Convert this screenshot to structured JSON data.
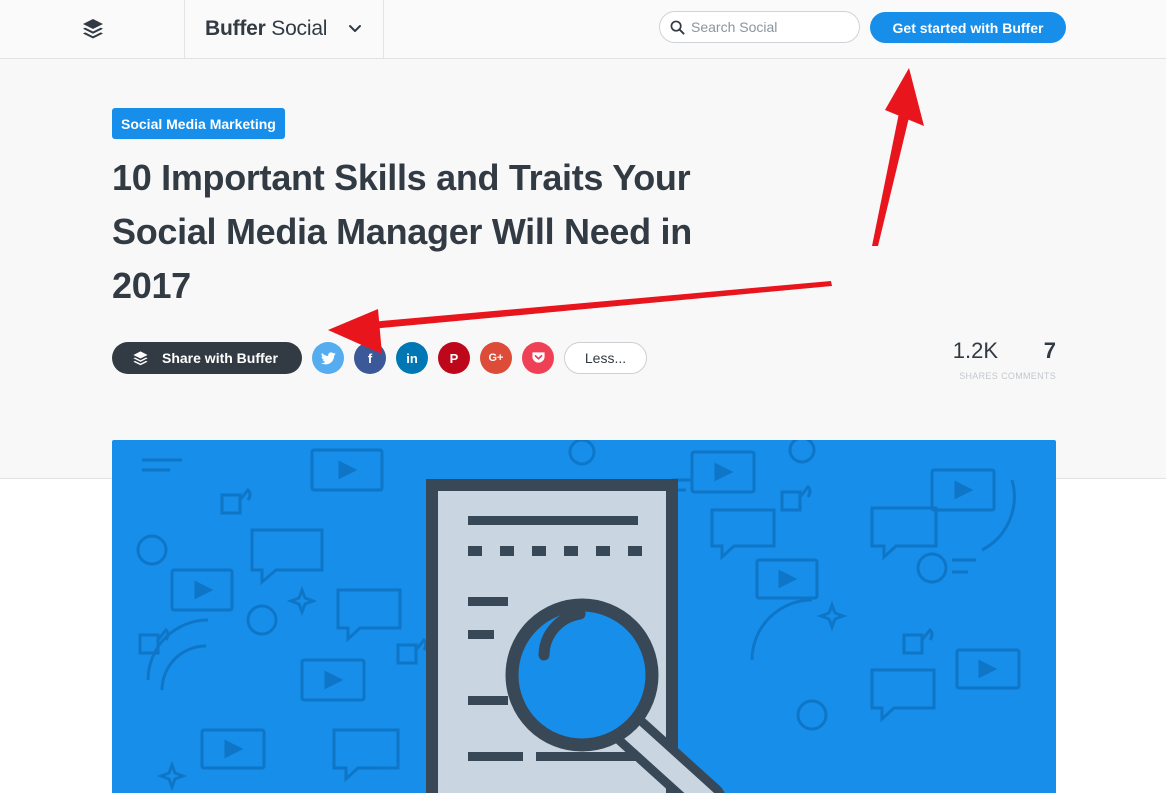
{
  "header": {
    "logo_icon": "buffer-stack-icon",
    "brand_name": "Buffer Social",
    "brand_menu_icon": "chevron-down-icon",
    "search": {
      "icon": "search-icon",
      "placeholder": "Search Social",
      "value": ""
    },
    "cta_label": "Get started with Buffer"
  },
  "article": {
    "category": "Social Media Marketing",
    "title": "10 Important Skills and Traits Your Social Media Manager Will Need in 2017",
    "share": {
      "buffer_label": "Share with Buffer",
      "networks": [
        {
          "name": "twitter",
          "icon": "twitter-icon",
          "glyph": "",
          "color": "#55acee"
        },
        {
          "name": "facebook",
          "icon": "facebook-icon",
          "glyph": "f",
          "color": "#3b5998"
        },
        {
          "name": "linkedin",
          "icon": "linkedin-icon",
          "glyph": "in",
          "color": "#0077b5"
        },
        {
          "name": "pinterest",
          "icon": "pinterest-icon",
          "glyph": "P",
          "color": "#bd081c"
        },
        {
          "name": "google-plus",
          "icon": "google-plus-icon",
          "glyph": "G+",
          "color": "#dd4b39"
        },
        {
          "name": "pocket",
          "icon": "pocket-icon",
          "glyph": "",
          "color": "#ef4056"
        }
      ],
      "less_label": "Less..."
    },
    "stats": {
      "shares_value": "1.2K",
      "shares_label": "SHARES",
      "comments_value": "7",
      "comments_label": "COMMENTS"
    },
    "featured_image": {
      "icon": "document-magnifier-illustration",
      "background_color": "#168eea"
    }
  },
  "annotations": {
    "arrow_color": "#e8151c",
    "arrows": [
      "arrow-to-get-started-button",
      "arrow-to-share-buttons"
    ]
  }
}
